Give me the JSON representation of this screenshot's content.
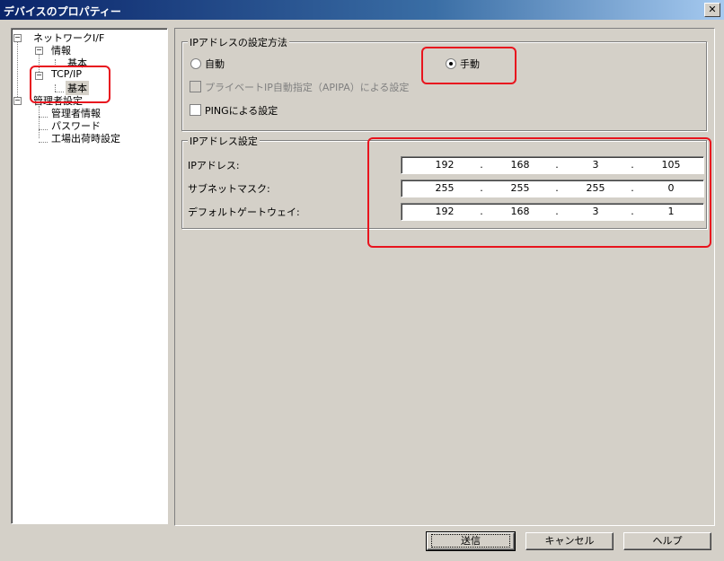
{
  "window": {
    "title": "デバイスのプロパティー"
  },
  "tree": {
    "network_if": "ネットワークI/F",
    "info": "情報",
    "info_basic": "基本",
    "tcpip": "TCP/IP",
    "tcpip_basic": "基本",
    "admin_settings": "管理者設定",
    "admin_info": "管理者情報",
    "password": "パスワード",
    "factory_settings": "工場出荷時設定"
  },
  "ip_method": {
    "title": "IPアドレスの設定方法",
    "auto_label": "自動",
    "manual_label": "手動",
    "selected": "manual",
    "apipa_label": "プライベートIP自動指定（APIPA）による設定",
    "apipa_checked": false,
    "ping_label": "PINGによる設定",
    "ping_checked": false
  },
  "ip_settings": {
    "title": "IPアドレス設定",
    "rows": [
      {
        "label": "IPアドレス:",
        "octets": [
          "192",
          "168",
          "3",
          "105"
        ]
      },
      {
        "label": "サブネットマスク:",
        "octets": [
          "255",
          "255",
          "255",
          "0"
        ]
      },
      {
        "label": "デフォルトゲートウェイ:",
        "octets": [
          "192",
          "168",
          "3",
          "1"
        ]
      }
    ]
  },
  "buttons": {
    "send": "送信",
    "cancel": "キャンセル",
    "help": "ヘルプ"
  },
  "colors": {
    "highlight": "#e8141e",
    "title_bar": "#0a246a"
  }
}
